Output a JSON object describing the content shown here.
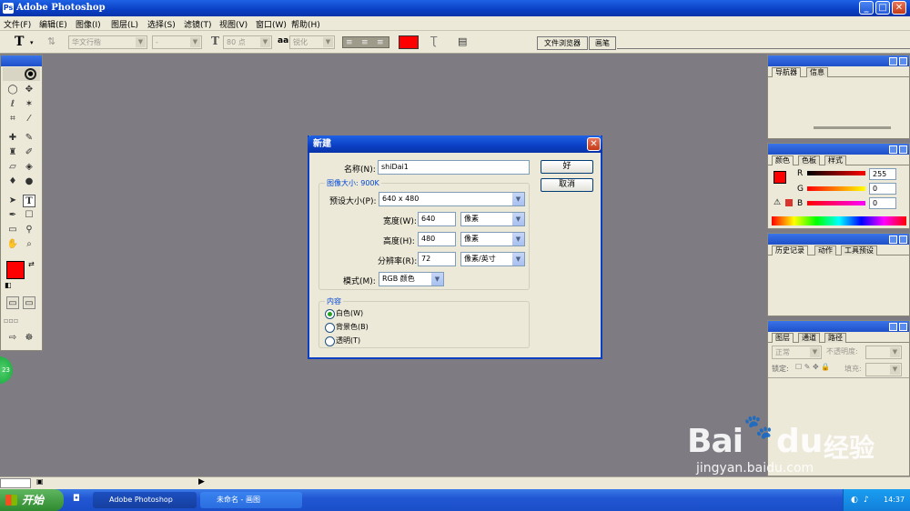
{
  "window": {
    "icon_letter": "Ps",
    "title": "Adobe Photoshop",
    "btn_min": "_",
    "btn_max": "□",
    "btn_close": "✕"
  },
  "menu": [
    "文件(F)",
    "编辑(E)",
    "图像(I)",
    "图层(L)",
    "选择(S)",
    "滤镜(T)",
    "视图(V)",
    "窗口(W)",
    "帮助(H)"
  ],
  "options": {
    "tool_glyph": "T",
    "font_family": "华文行楷",
    "font_style": "-",
    "font_size": "80 点",
    "aa_label": "aa",
    "antialias": "锐化",
    "color": "#ff0000",
    "tabs": [
      "文件浏览器",
      "画笔"
    ]
  },
  "panels": {
    "navigator_tabs": [
      "导航器",
      "信息"
    ],
    "color_tabs": [
      "颜色",
      "色板",
      "样式"
    ],
    "color_rows": [
      {
        "label": "R",
        "value": "255"
      },
      {
        "label": "G",
        "value": "0"
      },
      {
        "label": "B",
        "value": "0"
      }
    ],
    "history_tabs": [
      "历史记录",
      "动作",
      "工具预设"
    ],
    "layers_tabs": [
      "图层",
      "通道",
      "路径"
    ],
    "layers_blend": "正常",
    "layers_opacity_label": "不透明度:",
    "layers_lock_label": "锁定:",
    "layers_fill_label": "填充:"
  },
  "dialog": {
    "title": "新建",
    "name_label": "名称(N):",
    "name_value": "shiDai1",
    "ok": "好",
    "cancel": "取消",
    "image_size_label": "图像大小: 900K",
    "preset_label": "预设大小(P):",
    "preset_value": "640 x 480",
    "width_label": "宽度(W):",
    "width_value": "640",
    "width_unit": "像素",
    "height_label": "高度(H):",
    "height_value": "480",
    "height_unit": "像素",
    "resolution_label": "分辨率(R):",
    "resolution_value": "72",
    "resolution_unit": "像素/英寸",
    "mode_label": "模式(M):",
    "mode_value": "RGB 颜色",
    "contents_label": "内容",
    "contents_options": [
      "白色(W)",
      "背景色(B)",
      "透明(T)"
    ],
    "contents_selected": 0
  },
  "taskbar": {
    "start": "开始",
    "items": [
      "Adobe Photoshop",
      "未命名 - 画图"
    ],
    "clock": "14:37"
  },
  "watermark": {
    "brand": "Bai",
    "brand2": "du",
    "brand3": "经验",
    "url": "jingyan.baidu.com"
  },
  "badge": "23",
  "fg_color": "#ff0000",
  "bg_color": "#ffffff"
}
